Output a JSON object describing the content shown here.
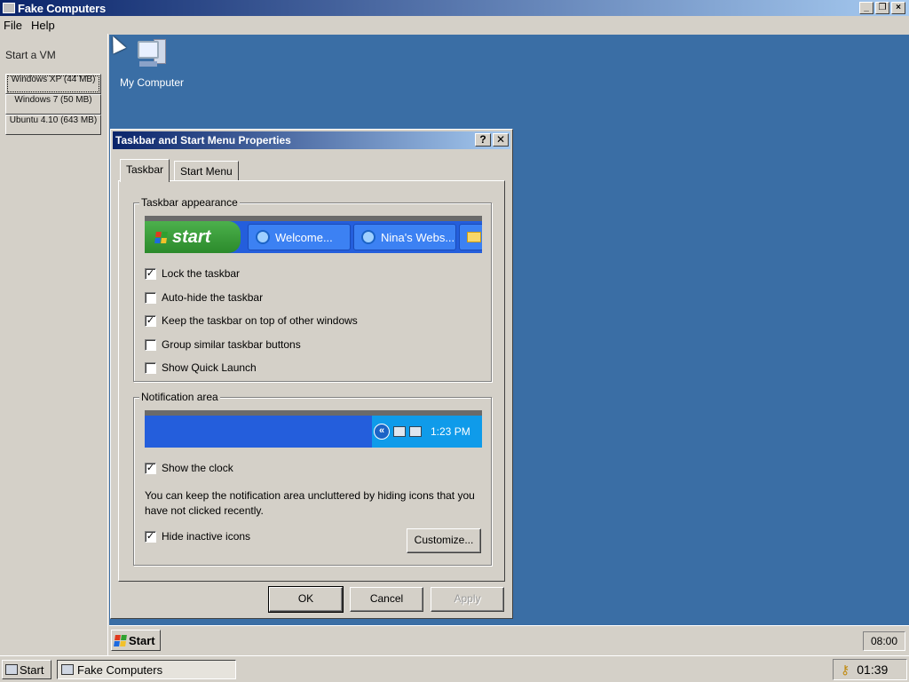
{
  "app": {
    "title": "Fake Computers",
    "menu": [
      "File",
      "Help"
    ]
  },
  "left_panel": {
    "heading": "Start a VM",
    "vms": [
      {
        "label": "Windows XP (44 MB)"
      },
      {
        "label": "Windows 7 (50 MB)"
      },
      {
        "label": "Ubuntu 4.10 (643 MB)"
      }
    ]
  },
  "guest_desktop": {
    "icons": [
      {
        "label": "My Computer",
        "icon": "my-computer-icon"
      }
    ],
    "taskbar": {
      "start_label": "Start",
      "clock": "08:00"
    }
  },
  "dialog": {
    "title": "Taskbar and Start Menu Properties",
    "title_buttons": [
      "?",
      "✕"
    ],
    "tabs": [
      {
        "label": "Taskbar",
        "active": true
      },
      {
        "label": "Start Menu",
        "active": false
      }
    ],
    "appearance": {
      "legend": "Taskbar appearance",
      "preview": {
        "start_label": "start",
        "buttons": [
          "Welcome...",
          "Nina's Webs..."
        ]
      },
      "options": [
        {
          "label": "Lock the taskbar",
          "checked": true
        },
        {
          "label": "Auto-hide the taskbar",
          "checked": false
        },
        {
          "label": "Keep the taskbar on top of other windows",
          "checked": true
        },
        {
          "label": "Group similar taskbar buttons",
          "checked": false
        },
        {
          "label": "Show Quick Launch",
          "checked": false
        }
      ]
    },
    "notification": {
      "legend": "Notification area",
      "preview_time": "1:23 PM",
      "show_clock": {
        "label": "Show the clock",
        "checked": true
      },
      "note": "You can keep the notification area uncluttered by hiding icons that you have not clicked recently.",
      "hide_inactive": {
        "label": "Hide inactive icons",
        "checked": true
      },
      "customize_label": "Customize..."
    },
    "buttons": {
      "ok": "OK",
      "cancel": "Cancel",
      "apply": "Apply"
    }
  },
  "host_taskbar": {
    "start_label": "Start",
    "task_label": "Fake Computers",
    "clock": "01:39"
  }
}
